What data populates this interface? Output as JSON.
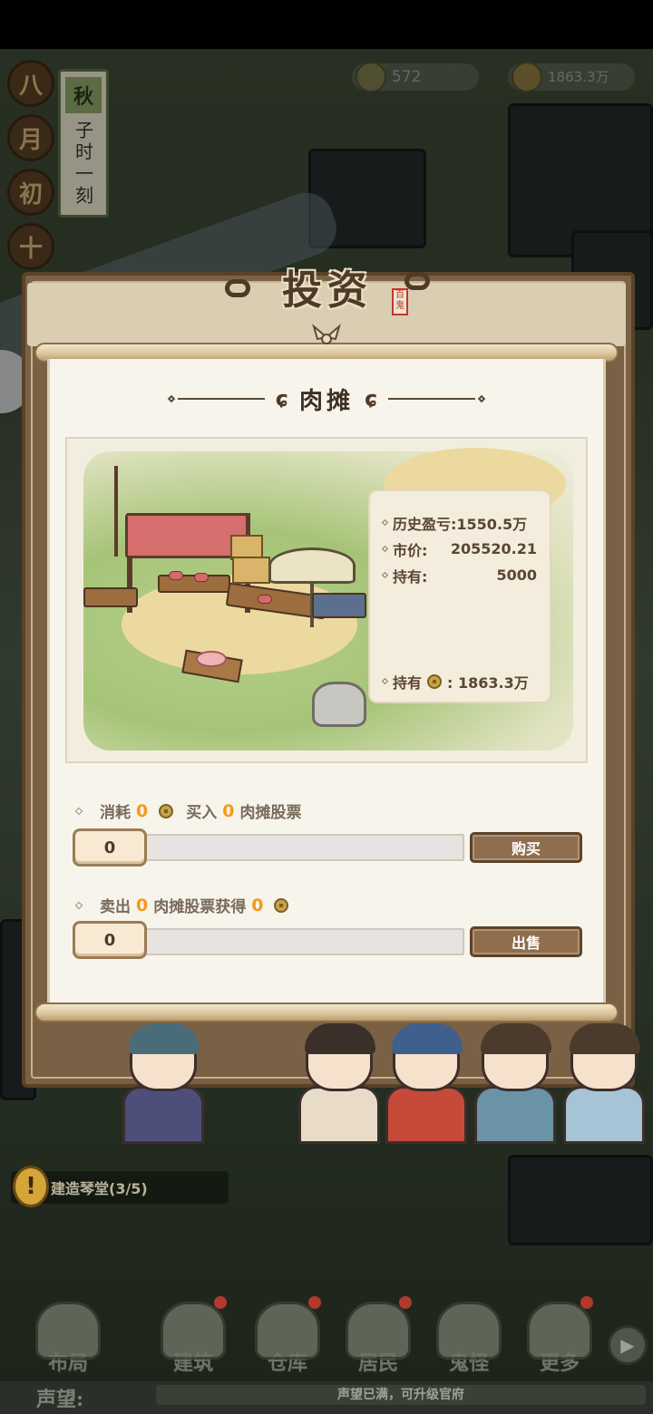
{
  "calendar": {
    "month_chars": [
      "八",
      "月",
      "初",
      "十"
    ],
    "season": "秋",
    "time": "子时一刻"
  },
  "resources": {
    "item_count": "572",
    "coin_amount": "1863.3万"
  },
  "modal": {
    "title": "投资",
    "seal": "百鬼",
    "stall_name": "肉摊",
    "info": {
      "history_label": "历史盈亏:",
      "history_value": "1550.5万",
      "price_label": "市价:",
      "price_value": "205520.21",
      "holding_label": "持有:",
      "holding_value": "5000",
      "coins_label": "持有",
      "coins_value": ": 1863.3万"
    },
    "buy": {
      "consume_label": "消耗",
      "consume_value": "0",
      "buy_label": "买入",
      "buy_value": "0",
      "stock_label": "肉摊股票",
      "quantity": "0",
      "button": "购买"
    },
    "sell": {
      "sell_label": "卖出",
      "sell_value": "0",
      "gain_label": "肉摊股票获得",
      "gain_value": "0",
      "quantity": "0",
      "button": "出售"
    }
  },
  "quest": {
    "icon": "!",
    "text": "建造琴堂(3/5)"
  },
  "nav": {
    "items": [
      {
        "label": "布局",
        "badge": false
      },
      {
        "label": "建筑",
        "badge": true
      },
      {
        "label": "仓库",
        "badge": true
      },
      {
        "label": "居民",
        "badge": true
      },
      {
        "label": "鬼怪",
        "badge": false
      },
      {
        "label": "更多",
        "badge": true
      }
    ]
  },
  "footer": {
    "fame_label": "声望:",
    "fame_text": "声望已满，可升级官府"
  },
  "colors": {
    "accent_orange": "#f29a1c",
    "button_brown": "#8f6e4f",
    "paper": "#f7f4ec"
  }
}
